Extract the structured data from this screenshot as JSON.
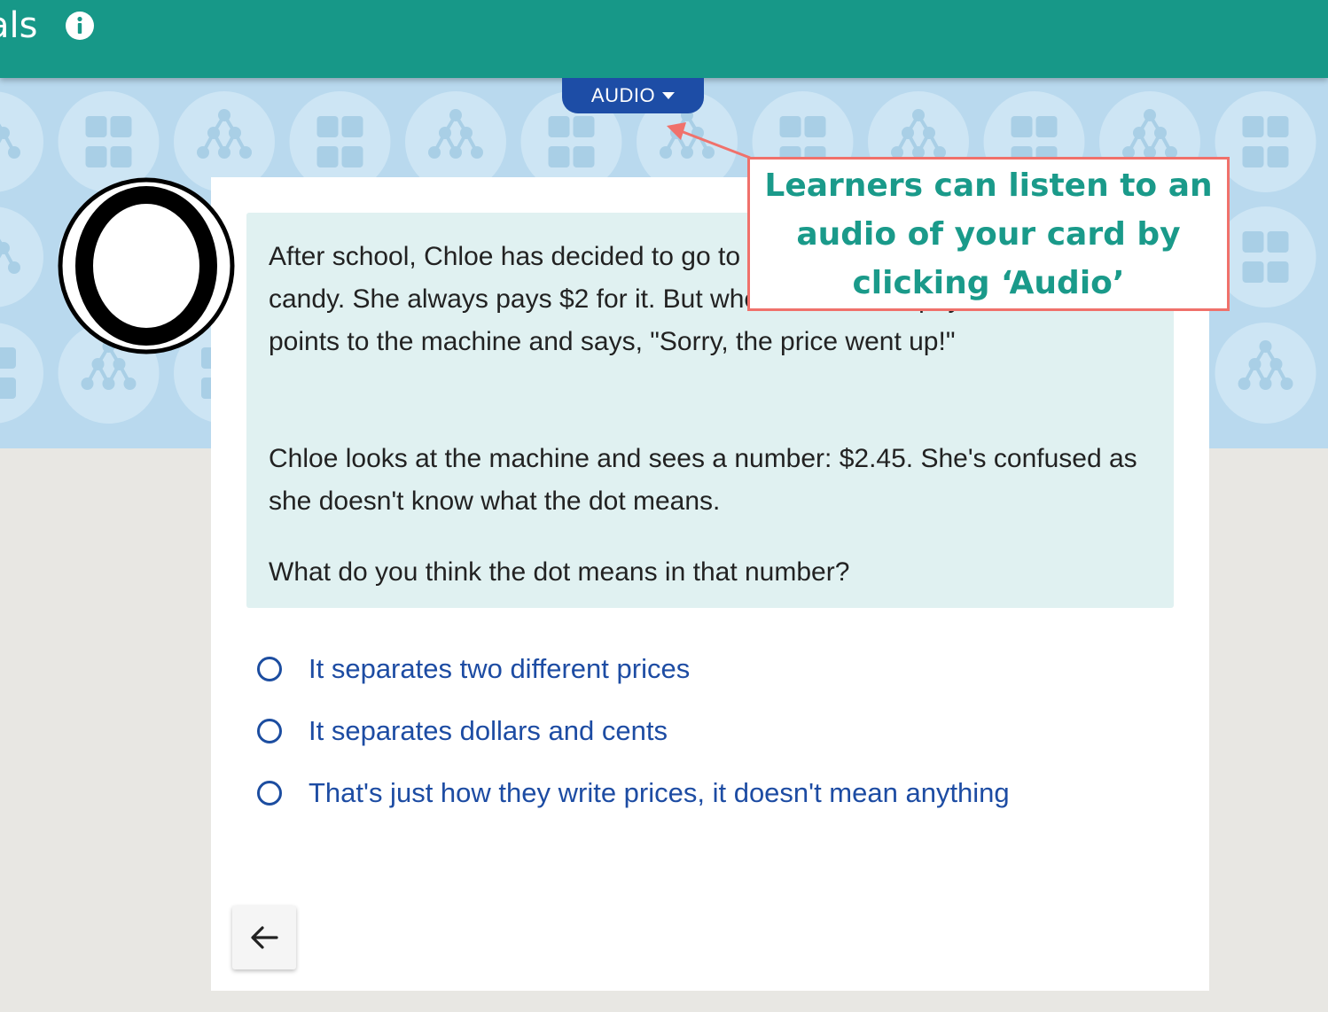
{
  "header": {
    "title_fragment": "als",
    "info_icon": "info-icon"
  },
  "audio_button": {
    "label": "AUDIO",
    "icon": "caret-down-icon"
  },
  "colors": {
    "header": "#179888",
    "pattern_band": "#b9d9ee",
    "story_panel": "#e0f1f1",
    "accent_blue": "#1d4da6",
    "callout_border": "#f0716b",
    "callout_text": "#1a9a8a"
  },
  "story": {
    "paragraph_1": "After school, Chloe has decided to go to the store to buy her favourite candy. She always pays $2 for it. But when she tries to pay, the cashier points to the machine and says, \"Sorry, the price went up!\"",
    "paragraph_2": "Chloe looks at the machine and sees a number: $2.45. She's confused as she doesn't know what the dot means.",
    "question": "What do you think the dot means in that number?"
  },
  "options": [
    {
      "label": "It separates two different prices"
    },
    {
      "label": "It separates dollars and cents"
    },
    {
      "label": "That's just how they write prices, it doesn't mean anything"
    }
  ],
  "navigation": {
    "back_icon": "arrow-left-icon"
  },
  "callout": {
    "text": "Learners can listen to an audio of your card by clicking ‘Audio’"
  }
}
